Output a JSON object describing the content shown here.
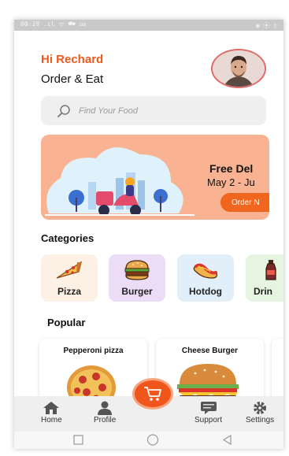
{
  "status_bar": {
    "left": "00:19 .ıl ᯤ 🗪 ⅏",
    "right": "◉ ⦿ ▯"
  },
  "header": {
    "greeting": "Hi Rechard",
    "subtitle": "Order & Eat",
    "avatar_icon": "user-avatar"
  },
  "search": {
    "placeholder": "Find Your Food",
    "icon": "search-icon"
  },
  "banner": {
    "title": "Free Del",
    "date": "May 2 - Ju",
    "button_label": "Order N"
  },
  "categories": {
    "title": "Categories",
    "items": [
      {
        "label": "Pizza",
        "icon": "pizza-icon",
        "bg": "#fdf0e4"
      },
      {
        "label": "Burger",
        "icon": "burger-icon",
        "bg": "#eddcf5"
      },
      {
        "label": "Hotdog",
        "icon": "hotdog-icon",
        "bg": "#e2eef8"
      },
      {
        "label": "Drin",
        "icon": "drink-icon",
        "bg": "#e6f5e2"
      }
    ]
  },
  "popular": {
    "title": "Popular",
    "items": [
      {
        "title": "Pepperoni pizza"
      },
      {
        "title": "Cheese Burger"
      }
    ]
  },
  "bottom_nav": {
    "items": [
      {
        "label": "Home",
        "icon": "home-icon"
      },
      {
        "label": "Profile",
        "icon": "profile-icon"
      },
      {
        "label": "Support",
        "icon": "support-icon"
      },
      {
        "label": "Settings",
        "icon": "settings-icon"
      }
    ],
    "cart_icon": "cart-icon"
  },
  "colors": {
    "accent": "#ee5a1d",
    "banner_bg": "#f9b393"
  }
}
